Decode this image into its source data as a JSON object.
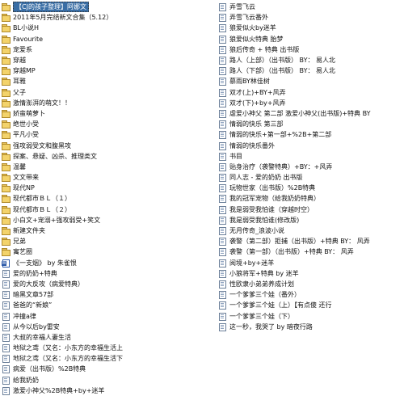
{
  "left_items": [
    {
      "label": "【CJ的孩子整理】阿娜文",
      "icon": "folder-icon"
    },
    {
      "label": "2011年5月完结新文合集（5.12）",
      "icon": "folder-icon"
    },
    {
      "label": "BL小说H",
      "icon": "folder-icon"
    },
    {
      "label": "Favourite",
      "icon": "folder-icon"
    },
    {
      "label": "宠爱系",
      "icon": "folder-icon"
    },
    {
      "label": "穿越",
      "icon": "folder-icon"
    },
    {
      "label": "穿越MP",
      "icon": "folder-icon"
    },
    {
      "label": "耳雅",
      "icon": "folder-icon"
    },
    {
      "label": "父子",
      "icon": "folder-icon"
    },
    {
      "label": "激情澎湃的萌文！！",
      "icon": "folder-icon"
    },
    {
      "label": "娇蛮萌萝卜",
      "icon": "folder-icon"
    },
    {
      "label": "绝世小受",
      "icon": "folder-icon"
    },
    {
      "label": "平凡小受",
      "icon": "folder-icon"
    },
    {
      "label": "强攻弱受文和腹黑攻",
      "icon": "folder-icon"
    },
    {
      "label": "探案、悬疑、凶杀、推理类文",
      "icon": "folder-icon"
    },
    {
      "label": "温馨",
      "icon": "folder-icon"
    },
    {
      "label": "文文带来",
      "icon": "folder-icon"
    },
    {
      "label": "现代NP",
      "icon": "folder-icon"
    },
    {
      "label": "现代都市ＢＬ（１）",
      "icon": "folder-icon"
    },
    {
      "label": "现代都市ＢＬ（２）",
      "icon": "folder-icon"
    },
    {
      "label": "小白文+宠溺+强攻弱受+笑文",
      "icon": "folder-icon"
    },
    {
      "label": "新建文件夹",
      "icon": "folder-icon"
    },
    {
      "label": "兄弟",
      "icon": "folder-icon"
    },
    {
      "label": "寓艺圈",
      "icon": "folder-icon"
    },
    {
      "label": "《一支烟》 by 朱雀恨",
      "icon": "doc-icon"
    },
    {
      "label": "爱的奶奶+特典",
      "icon": "txt-icon"
    },
    {
      "label": "爱的大反攻（病爱特典）",
      "icon": "txt-icon"
    },
    {
      "label": "暗黑文章57部",
      "icon": "txt-icon"
    },
    {
      "label": "爸爸的“新娘”",
      "icon": "txt-icon"
    },
    {
      "label": "冲撞a律",
      "icon": "txt-icon"
    },
    {
      "label": "从今以后by雷安",
      "icon": "txt-icon"
    },
    {
      "label": "大叔的幸福人妻生活",
      "icon": "txt-icon"
    },
    {
      "label": "地狱之鸢（又名：小东方的幸福生活上",
      "icon": "txt-icon"
    },
    {
      "label": "地狱之鸢（又名：小东方的幸福生活下",
      "icon": "txt-icon"
    },
    {
      "label": "病爱（出书版）%2B特典",
      "icon": "txt-icon"
    },
    {
      "label": "给我奶奶",
      "icon": "txt-icon"
    },
    {
      "label": "激爱小神父%2B特典+by+迷羊",
      "icon": "txt-icon"
    }
  ],
  "right_items": [
    {
      "label": "弄雪飞云",
      "icon": "txt-icon"
    },
    {
      "label": "弄雪飞云番外",
      "icon": "txt-icon"
    },
    {
      "label": "狼爱似火by迷羊",
      "icon": "txt-icon"
    },
    {
      "label": "狼爱似火特典 胎梦",
      "icon": "txt-icon"
    },
    {
      "label": "狼后传奇 + 特典 出书版",
      "icon": "txt-icon"
    },
    {
      "label": "路人（上部）（出书版） BY： 易人北",
      "icon": "txt-icon"
    },
    {
      "label": "路人（下部）（出书版） BY： 易人北",
      "icon": "txt-icon"
    },
    {
      "label": "慕雨BY林佳树",
      "icon": "txt-icon"
    },
    {
      "label": "双才(上)+BY+风弄",
      "icon": "txt-icon"
    },
    {
      "label": "双才(下)+by+风弄",
      "icon": "txt-icon"
    },
    {
      "label": "虐爱小神父 第二部 激爱小神父(出书版)+特典 BY",
      "icon": "txt-icon"
    },
    {
      "label": "情弱的快乐 第三部",
      "icon": "txt-icon"
    },
    {
      "label": "情弱的快乐+第一部+%2B+第二部",
      "icon": "txt-icon"
    },
    {
      "label": "情弱的快乐番外",
      "icon": "txt-icon"
    },
    {
      "label": "书目",
      "icon": "txt-icon"
    },
    {
      "label": "贴身治疗（袭警特典）+BY：+风弄",
      "icon": "txt-icon"
    },
    {
      "label": "同人志 - 爱的奶奶 出书版",
      "icon": "txt-icon"
    },
    {
      "label": "玩物世家（出书版）%2B特典",
      "icon": "txt-icon"
    },
    {
      "label": "我的冠军宠物（给我奶奶特典）",
      "icon": "txt-icon"
    },
    {
      "label": "我是弱受我怕谁（穿越时空）",
      "icon": "txt-icon"
    },
    {
      "label": "我是弱受我怕谁(修改版)",
      "icon": "txt-icon"
    },
    {
      "label": "无月传奇_浪波小说",
      "icon": "txt-icon"
    },
    {
      "label": "袭警（第二部）拒捕（出书版）+特典 BY： 风弄",
      "icon": "txt-icon"
    },
    {
      "label": "袭警（第一部）（出书版）+特典 BY： 风弄",
      "icon": "txt-icon"
    },
    {
      "label": "阅境+by+迷羊",
      "icon": "txt-icon"
    },
    {
      "label": "小狼将军+特典 by 迷羊",
      "icon": "txt-icon"
    },
    {
      "label": "性欧隶小弟弟养成计划",
      "icon": "txt-icon"
    },
    {
      "label": "一个爹爹三个娃（番外）",
      "icon": "txt-icon"
    },
    {
      "label": "一个爹爹三个娃（上）【有点傻 还行",
      "icon": "txt-icon"
    },
    {
      "label": "一个爹爹三个娃（下）",
      "icon": "txt-icon"
    },
    {
      "label": "这一秒，我哭了 by 暗夜行路",
      "icon": "txt-icon"
    }
  ]
}
